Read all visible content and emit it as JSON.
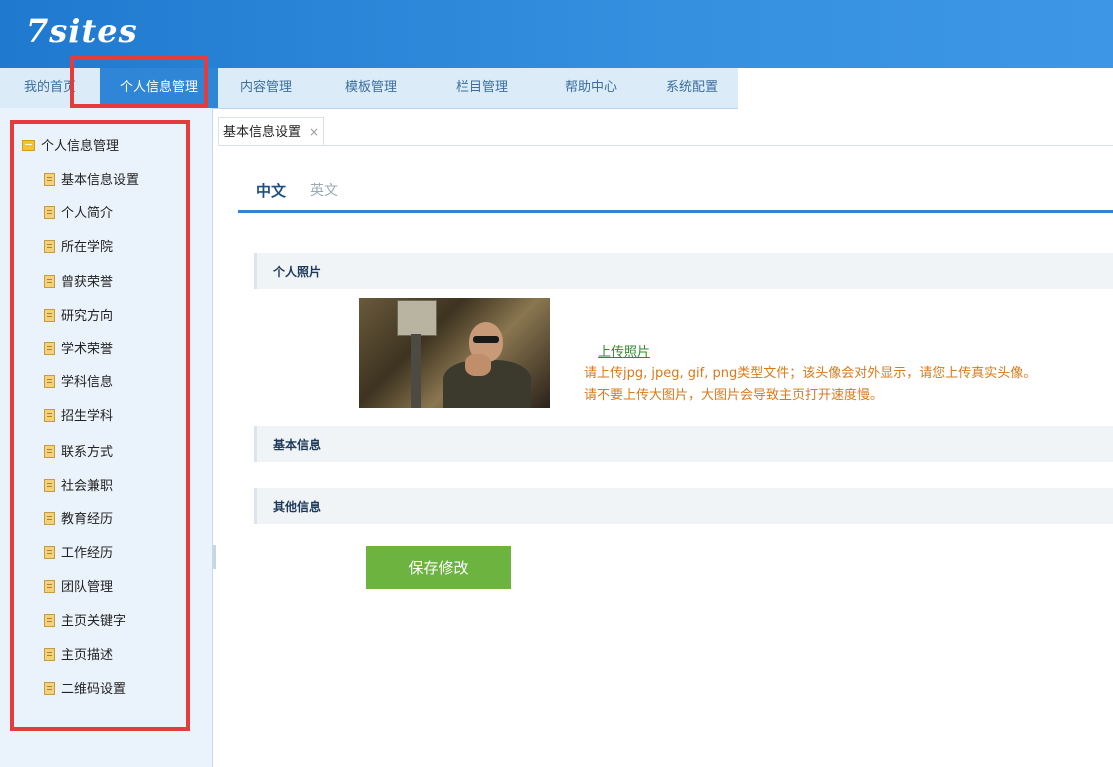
{
  "app": {
    "logo": "7sites"
  },
  "nav": {
    "items": [
      {
        "label": "我的首页"
      },
      {
        "label": "个人信息管理"
      },
      {
        "label": "内容管理"
      },
      {
        "label": "模板管理"
      },
      {
        "label": "栏目管理"
      },
      {
        "label": "帮助中心"
      },
      {
        "label": "系统配置"
      }
    ],
    "active_index": 1
  },
  "sidebar": {
    "root": {
      "label": "个人信息管理",
      "icon": "folder-icon"
    },
    "items": [
      {
        "label": "基本信息设置",
        "icon": "page-icon"
      },
      {
        "label": "个人简介",
        "icon": "page-icon"
      },
      {
        "label": "所在学院",
        "icon": "page-icon"
      },
      {
        "label": "曾获荣誉",
        "icon": "page-icon"
      },
      {
        "label": "研究方向",
        "icon": "page-icon"
      },
      {
        "label": "学术荣誉",
        "icon": "page-icon"
      },
      {
        "label": "学科信息",
        "icon": "page-icon"
      },
      {
        "label": "招生学科",
        "icon": "page-icon"
      },
      {
        "label": "联系方式",
        "icon": "page-icon"
      },
      {
        "label": "社会兼职",
        "icon": "page-icon"
      },
      {
        "label": "教育经历",
        "icon": "page-icon"
      },
      {
        "label": "工作经历",
        "icon": "page-icon"
      },
      {
        "label": "团队管理",
        "icon": "page-icon"
      },
      {
        "label": "主页关键字",
        "icon": "page-icon"
      },
      {
        "label": "主页描述",
        "icon": "page-icon"
      },
      {
        "label": "二维码设置",
        "icon": "page-icon"
      }
    ]
  },
  "content": {
    "open_tab": {
      "label": "基本信息设置",
      "close": "×"
    },
    "lang_tabs": {
      "zh": "中文",
      "en": "英文",
      "active": "zh"
    },
    "sections": {
      "photo": "个人照片",
      "basic": "基本信息",
      "other": "其他信息"
    },
    "upload": {
      "link": "上传照片",
      "hint1": "请上传jpg, jpeg, gif, png类型文件；该头像会对外显示，请您上传真实头像。",
      "hint2": "请不要上传大图片，大图片会导致主页打开速度慢。"
    },
    "save_label": "保存修改"
  },
  "colors": {
    "header": "#2f86d6",
    "highlight": "#e23c3c",
    "save": "#6db33f",
    "upload_link": "#2e8a2e",
    "hint": "#d87a19"
  }
}
